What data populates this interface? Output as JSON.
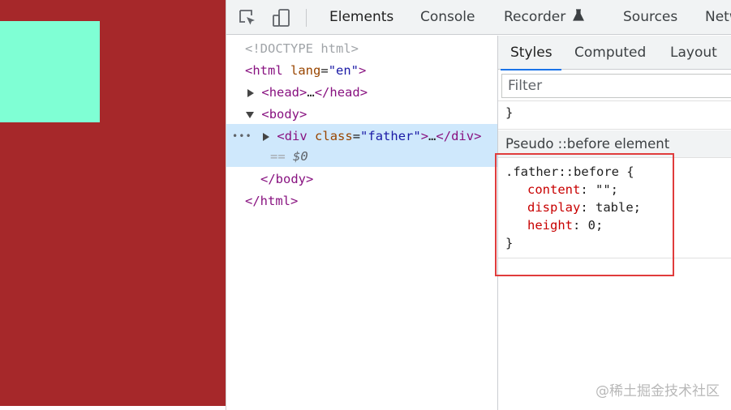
{
  "colors": {
    "page_background": "#a6282a",
    "inner_box": "#7fffd4",
    "accent": "#1a73e8",
    "selected_row": "#cfe8fc",
    "highlight_border": "#e03c3c"
  },
  "toolbar": {
    "inspect_icon": "inspect-element-icon",
    "device_icon": "device-toggle-icon",
    "tabs": [
      "Elements",
      "Console",
      "Recorder",
      "Sources",
      "Netw"
    ],
    "recorder_icon": "flask-icon"
  },
  "dom": {
    "doctype": "<!DOCTYPE html>",
    "html_open_tag": "html",
    "html_attr": "lang",
    "html_attr_value": "\"en\"",
    "head_tag": "head",
    "head_ellipsis": "…",
    "body_tag": "body",
    "div_tag": "div",
    "div_attr": "class",
    "div_attr_value": "\"father\"",
    "div_ellipsis": "…",
    "selected_marker": "== ",
    "selected_var": "$0",
    "row_dots": "•••",
    "body_close": "</body>",
    "html_close": "</html>"
  },
  "styles": {
    "subtabs": [
      "Styles",
      "Computed",
      "Layout"
    ],
    "filter_placeholder": "Filter",
    "prev_rule_close": "}",
    "pseudo_header": "Pseudo ::before element",
    "rule": {
      "selector": ".father::before {",
      "declarations": [
        {
          "name": "content",
          "value": " \"\";"
        },
        {
          "name": "display",
          "value": " table;"
        },
        {
          "name": "height",
          "value": " 0;"
        }
      ],
      "close": "}"
    }
  },
  "watermark": "@稀土掘金技术社区"
}
